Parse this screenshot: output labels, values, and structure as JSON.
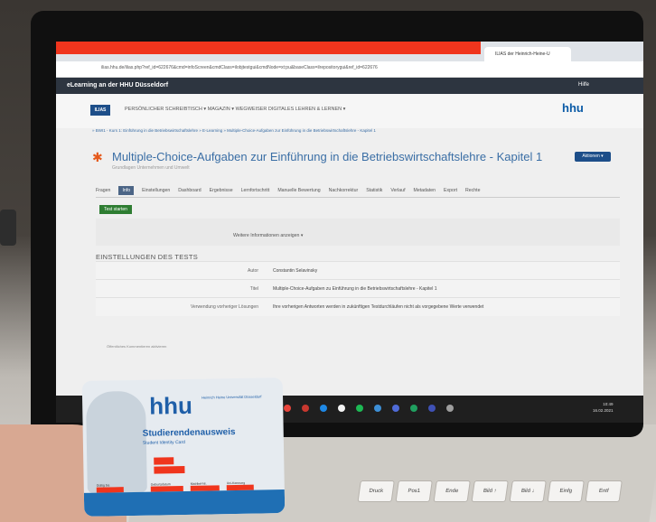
{
  "browser": {
    "tab_title": "ILIAS der Heinrich-Heine-U",
    "url": "ilias.hhu.de/ilias.php?ref_id=622676&cmd=infoScreen&cmdClass=ilobjtestgui&cmdNode=xt:pu&baseClass=ilrepositorygui&ref_id=622676"
  },
  "ilias_bar": {
    "title": "eLearning an der HHU Düsseldorf",
    "help": "Hilfe"
  },
  "nav": {
    "logo": "ILIAS",
    "menu": "PERSÖNLICHER SCHREIBTISCH ▾     MAGAZIN ▾     WEGWEISER DIGITALES LEHREN & LERNEN ▾",
    "hhu": "hhu"
  },
  "breadcrumb": "» BWI1 - Kurs 1: Einführung in die Betriebswirtschaftslehre  » E-Learning  » Multiple-Choice-Aufgaben zur Einführung in die Betriebswirtschaftslehre - Kapitel 1",
  "page": {
    "title": "Multiple-Choice-Aufgaben zur Einführung in die Betriebswirtschaftslehre - Kapitel 1",
    "subtitle": "Grundlagen Unternehmen und Umwelt",
    "actions_button": "Aktionen ▾"
  },
  "tabs": [
    {
      "label": "Fragen",
      "active": false
    },
    {
      "label": "Info",
      "active": true
    },
    {
      "label": "Einstellungen",
      "active": false
    },
    {
      "label": "Dashboard",
      "active": false
    },
    {
      "label": "Ergebnisse",
      "active": false
    },
    {
      "label": "Lernfortschritt",
      "active": false
    },
    {
      "label": "Manuelle Bewertung",
      "active": false
    },
    {
      "label": "Nachkorrektur",
      "active": false
    },
    {
      "label": "Statistik",
      "active": false
    },
    {
      "label": "Verlauf",
      "active": false
    },
    {
      "label": "Metadaten",
      "active": false
    },
    {
      "label": "Export",
      "active": false
    },
    {
      "label": "Rechte",
      "active": false
    }
  ],
  "start_button": "Test starten",
  "more_info": "Weitere Informationen anzeigen ▾",
  "section_title": "EINSTELLUNGEN DES TESTS",
  "settings_rows": [
    {
      "label": "Autor",
      "value": "Constantin Selavinsky"
    },
    {
      "label": "Titel",
      "value": "Multiple-Choice-Aufgaben zu Einführung in die Betriebswirtschaftslehre - Kapitel 1"
    },
    {
      "label": "Verwendung vorheriger Lösungen",
      "value": "Ihre vorherigen Antworten werden in zukünftigen Testdurchläufen nicht als vorgegebene Werte verwendet"
    }
  ],
  "footer_note": "Öffentliches Kommentieren aktivieren",
  "taskbar_clock": {
    "time": "10:49",
    "date": "16.02.2021"
  },
  "student_card": {
    "logo": "hhu",
    "logo_sub": "Heinrich Heine Universität Düsseldorf",
    "title": "Studierendenausweis",
    "subtitle": "Student Identity Card",
    "labels": [
      "Gültig bis",
      "Geburtsdatum",
      "Matrikel-Nr.",
      "Uni-Kennung"
    ]
  },
  "keyboard_keys": [
    "Druck",
    "Pos1",
    "Ende",
    "Bild ↑",
    "Bild ↓",
    "Einfg",
    "Entf"
  ],
  "colors": {
    "redaction": "#f0351d",
    "ilias_blue": "#1d4e89",
    "hhu_blue": "#1f5fa8",
    "start_green": "#2e7d32"
  }
}
